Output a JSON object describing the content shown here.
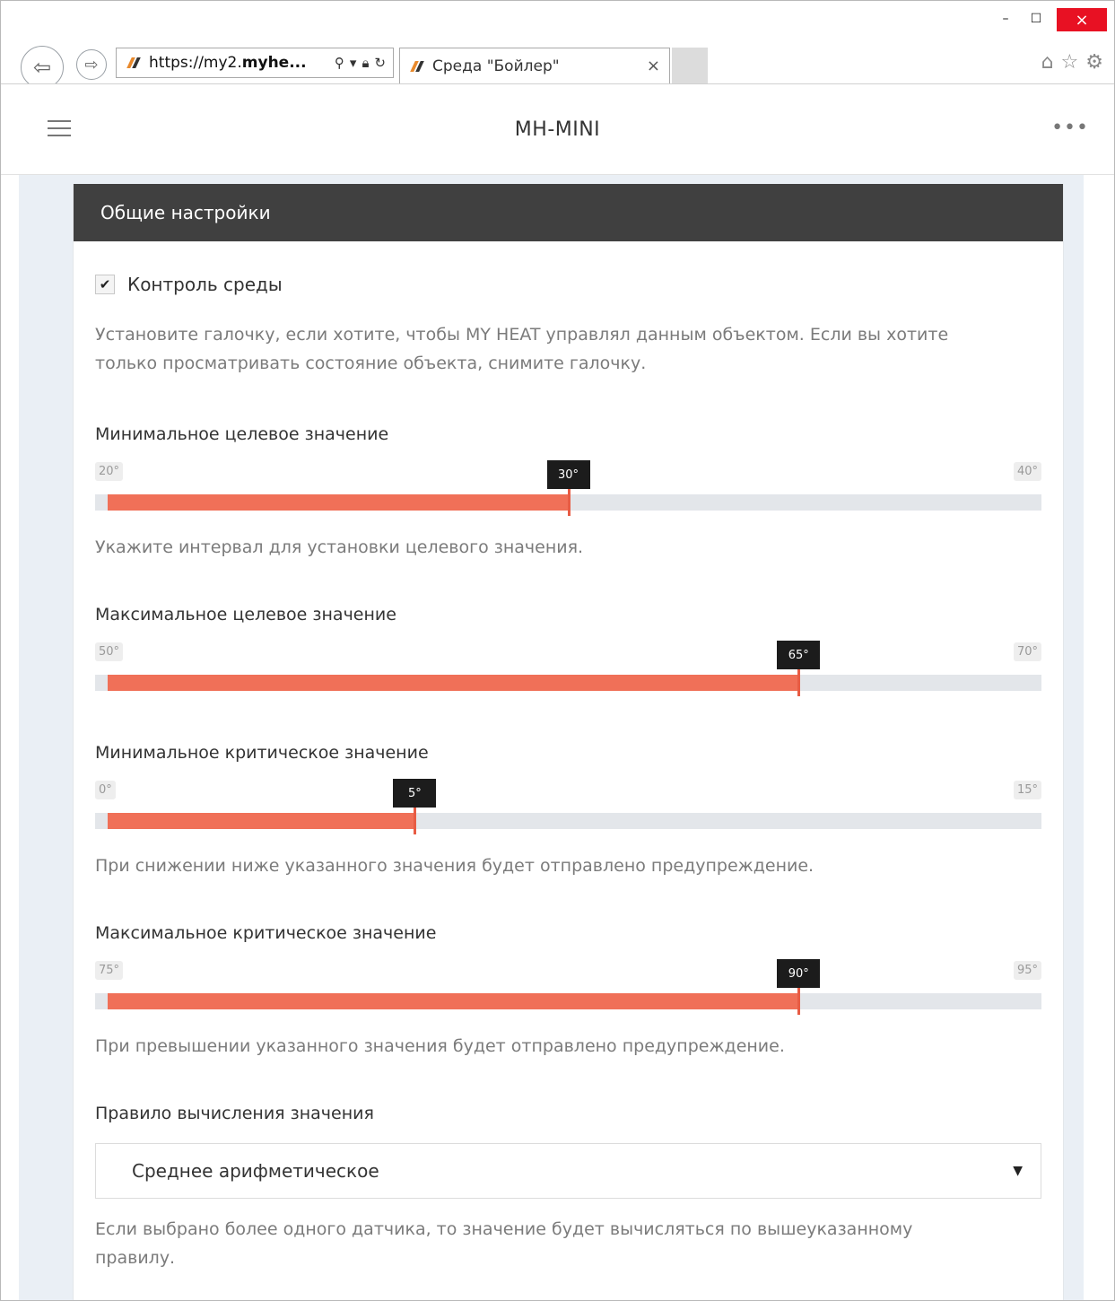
{
  "browser": {
    "address_scheme": "https://my2.",
    "address_host": "myhe...",
    "tab_title": "Среда \"Бойлер\"",
    "tab_close": "×",
    "window_controls": {
      "minimize": "–",
      "maximize": "☐",
      "close": "×"
    },
    "icons": [
      "back-icon",
      "forward-icon",
      "search-icon",
      "lock-icon",
      "refresh-icon",
      "home-icon",
      "star-icon",
      "gear-icon"
    ]
  },
  "app": {
    "title": "MH-MINI",
    "more": "•••"
  },
  "panel": {
    "header": "Общие настройки",
    "control": {
      "checked": true,
      "check_mark": "✔",
      "label": "Контроль среды",
      "help": "Установите галочку, если хотите, чтобы MY HEAT управлял данным объектом. Если вы хотите только просматривать состояние объекта, снимите галочку."
    },
    "sliders": [
      {
        "label": "Минимальное целевое значение",
        "min_label": "20°",
        "max_label": "40°",
        "value_label": "30°",
        "min": 20,
        "max": 40,
        "value": 30,
        "help": "Укажите интервал для установки целевого значения."
      },
      {
        "label": "Максимальное целевое значение",
        "min_label": "50°",
        "max_label": "70°",
        "value_label": "65°",
        "min": 50,
        "max": 70,
        "value": 65,
        "help": ""
      },
      {
        "label": "Минимальное критическое значение",
        "min_label": "0°",
        "max_label": "15°",
        "value_label": "5°",
        "min": 0,
        "max": 15,
        "value": 5,
        "help": "При снижении ниже указанного значения будет отправлено предупреждение."
      },
      {
        "label": "Максимальное критическое значение",
        "min_label": "75°",
        "max_label": "95°",
        "value_label": "90°",
        "min": 75,
        "max": 95,
        "value": 90,
        "help": "При превышении указанного значения будет отправлено предупреждение."
      }
    ],
    "rule": {
      "label": "Правило вычисления значения",
      "selected": "Среднее арифметическое",
      "help": "Если выбрано более одного датчика, то значение будет вычисляться по вышеуказанному правилу."
    }
  },
  "colors": {
    "accent": "#f07058",
    "header_bg": "#404040",
    "track": "#e3e6ea",
    "page_bg": "#eaeff5"
  }
}
